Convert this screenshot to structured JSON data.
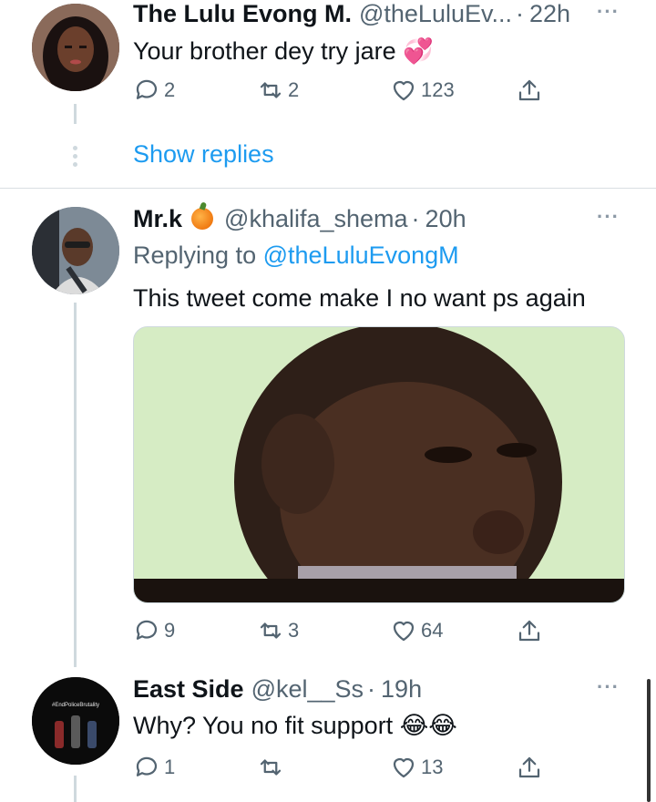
{
  "tweets": [
    {
      "name": "The Lulu Evong M.",
      "handle": "@theLuluEv...",
      "time": "22h",
      "text": "Your brother dey try jare 💞",
      "replies": "2",
      "retweets": "2",
      "likes": "123"
    },
    {
      "name": "Mr.k",
      "handle": "@khalifa_shema",
      "time": "20h",
      "replying_prefix": "Replying to",
      "replying_to": "@theLuluEvongM",
      "text": "This tweet come make I no want ps again",
      "replies": "9",
      "retweets": "3",
      "likes": "64"
    },
    {
      "name": "East Side",
      "handle": "@kel__Ss",
      "time": "19h",
      "text": "Why? You no fit support 😂😂",
      "avatar_text": "#EndPoliceBrutality",
      "replies": "1",
      "retweets": "",
      "likes": "13"
    }
  ],
  "show_replies": "Show replies",
  "dot": "·",
  "more": "···",
  "colors": {
    "accent": "#1d9bf0",
    "muted": "#536471",
    "text": "#0f1419"
  }
}
